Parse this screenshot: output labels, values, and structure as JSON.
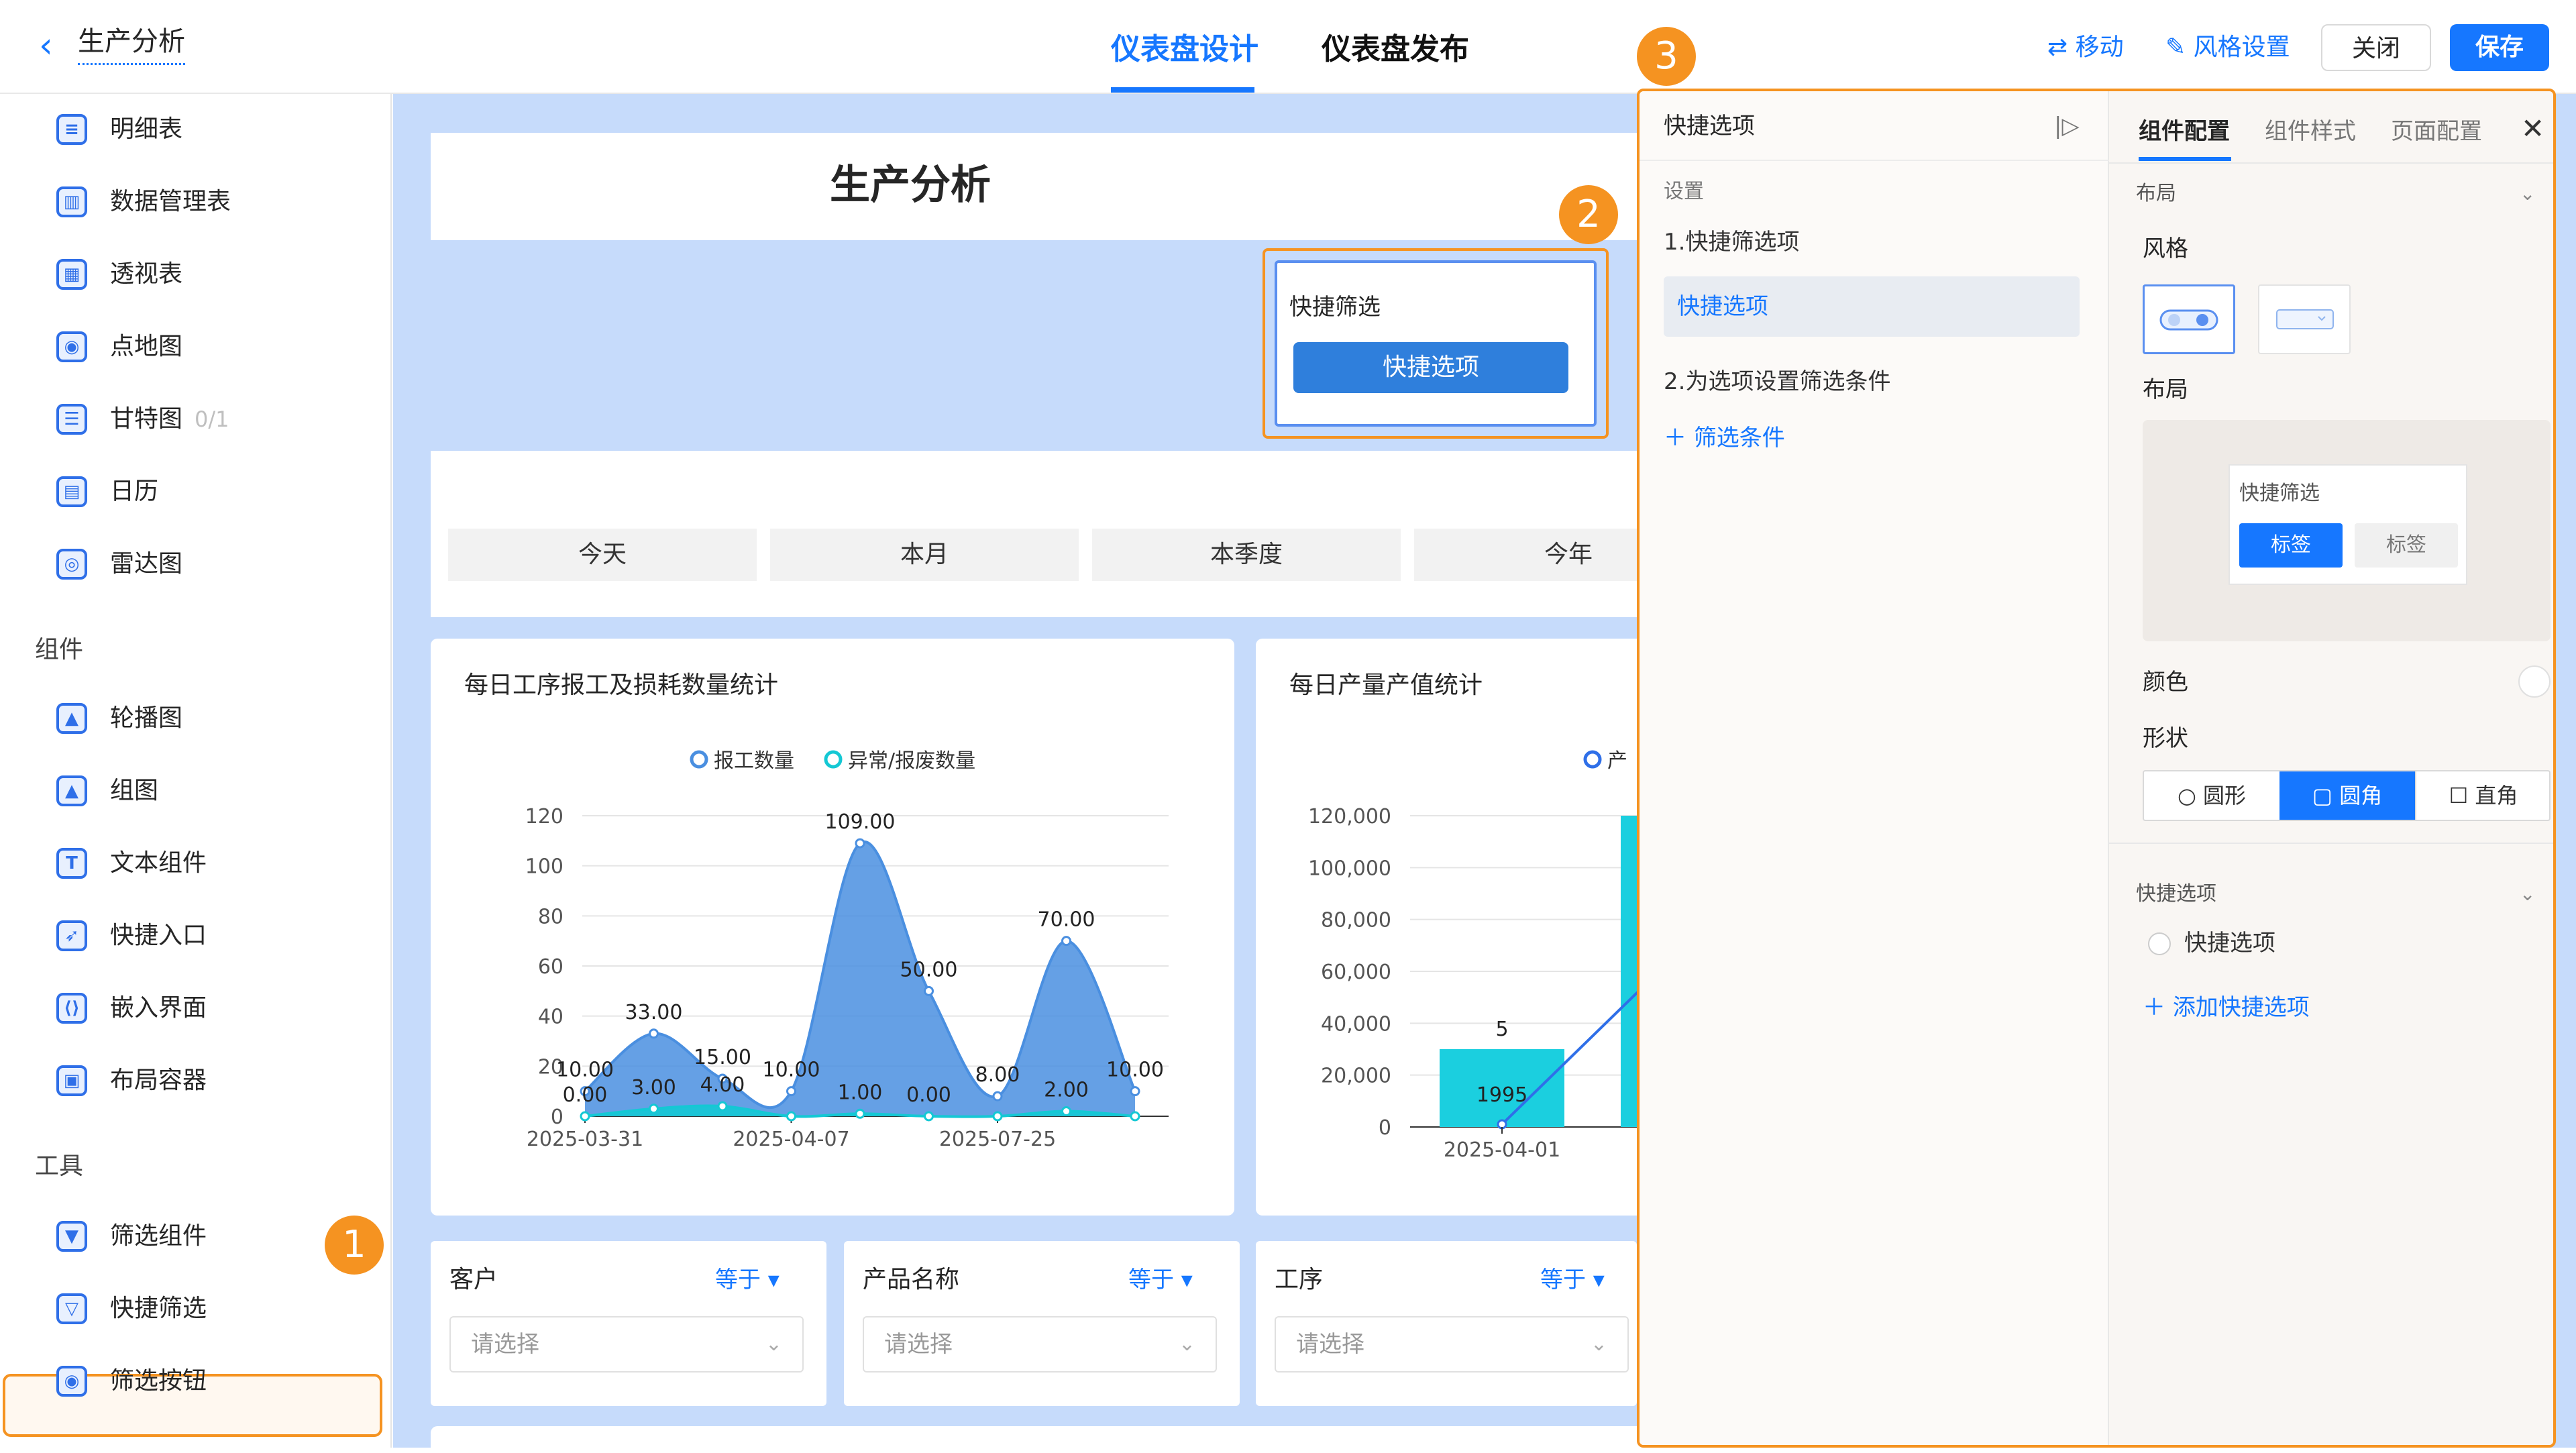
{
  "header": {
    "back_icon": "chevron-left-icon",
    "title": "生产分析",
    "tabs": [
      "仪表盘设计",
      "仪表盘发布"
    ],
    "active_tab": 0,
    "move_label": "移动",
    "style_label": "风格设置",
    "close_label": "关闭",
    "save_label": "保存"
  },
  "sidebar": {
    "items": [
      {
        "label": "明细表",
        "icon": "table-icon"
      },
      {
        "label": "数据管理表",
        "icon": "bar-chart-icon"
      },
      {
        "label": "透视表",
        "icon": "pivot-table-icon"
      },
      {
        "label": "点地图",
        "icon": "map-pin-icon"
      },
      {
        "label": "甘特图",
        "icon": "gantt-icon",
        "count": "0/1"
      },
      {
        "label": "日历",
        "icon": "calendar-icon"
      },
      {
        "label": "雷达图",
        "icon": "radar-icon"
      }
    ],
    "section_components": "组件",
    "components": [
      {
        "label": "轮播图",
        "icon": "image-icon"
      },
      {
        "label": "组图",
        "icon": "image-group-icon"
      },
      {
        "label": "文本组件",
        "icon": "text-icon"
      },
      {
        "label": "快捷入口",
        "icon": "rocket-icon"
      },
      {
        "label": "嵌入界面",
        "icon": "embed-icon"
      },
      {
        "label": "布局容器",
        "icon": "layout-icon"
      }
    ],
    "section_tools": "工具",
    "tools": [
      {
        "label": "筛选组件",
        "icon": "filter-icon"
      },
      {
        "label": "快捷筛选",
        "icon": "quick-filter-icon"
      },
      {
        "label": "筛选按钮",
        "icon": "filter-button-icon"
      }
    ]
  },
  "badges": [
    "1",
    "2",
    "3"
  ],
  "dashboard": {
    "title": "生产分析",
    "quick_filter": {
      "title": "快捷筛选",
      "button": "快捷选项"
    },
    "periods": [
      "今天",
      "本月",
      "本季度",
      "今年"
    ],
    "filters": [
      {
        "label": "客户",
        "op": "等于",
        "placeholder": "请选择"
      },
      {
        "label": "产品名称",
        "op": "等于",
        "placeholder": "请选择"
      },
      {
        "label": "工序",
        "op": "等于",
        "placeholder": "请选择"
      }
    ]
  },
  "chart_data": [
    {
      "type": "area",
      "title": "每日工序报工及损耗数量统计",
      "xlabel": "",
      "ylabel": "",
      "x_tick_labels": [
        "2025-03-31",
        "2025-04-07",
        "2025-07-25"
      ],
      "ylim": [
        0,
        120
      ],
      "yticks": [
        0,
        20,
        40,
        60,
        80,
        100,
        120
      ],
      "legend": "top-center",
      "series": [
        {
          "name": "报工数量",
          "color": "#4a8fe0",
          "values": [
            10,
            33,
            15,
            10,
            109,
            50,
            8,
            70,
            10
          ]
        },
        {
          "name": "异常/报废数量",
          "color": "#14c8d4",
          "values": [
            0,
            3,
            4,
            0,
            1,
            0,
            0,
            2,
            0
          ]
        }
      ],
      "data_labels": {
        "报工数量": [
          "10.00",
          "33.00",
          "15.00",
          "10.00",
          "109.00",
          "50.00",
          "8.00",
          "70.00",
          "10.00"
        ],
        "异常/报废数量": [
          "0.00",
          "3.00",
          "4.00",
          "",
          "1.00",
          "0.00",
          "",
          "2.00",
          ""
        ]
      }
    },
    {
      "type": "bar",
      "title": "每日产量产值统计",
      "legend_visible": "产",
      "ylim": [
        0,
        120000
      ],
      "yticks": [
        "0",
        "20,000",
        "40,000",
        "60,000",
        "80,000",
        "100,000",
        "120,000"
      ],
      "categories": [
        "2025-04-01"
      ],
      "bar_color": "#1bcfdf",
      "values": [
        30000,
        120000
      ],
      "bar_label": "5",
      "line_values": [
        1995
      ],
      "line_label": "1995"
    }
  ],
  "config_panel": {
    "left_title": "快捷选项",
    "settings_label": "设置",
    "step1": "1.快捷筛选项",
    "option_item": "快捷选项",
    "step2": "2.为选项设置筛选条件",
    "add_condition": "筛选条件",
    "tabs": [
      "组件配置",
      "组件样式",
      "页面配置"
    ],
    "section_layout": "布局",
    "style_label": "风格",
    "layout_label": "布局",
    "preview_title": "快捷筛选",
    "preview_tags": [
      "标签",
      "标签"
    ],
    "color_label": "颜色",
    "shape_label": "形状",
    "shapes": [
      "圆形",
      "圆角",
      "直角"
    ],
    "active_shape": 1,
    "section_quick": "快捷选项",
    "quick_option": "快捷选项",
    "add_quick": "添加快捷选项"
  }
}
